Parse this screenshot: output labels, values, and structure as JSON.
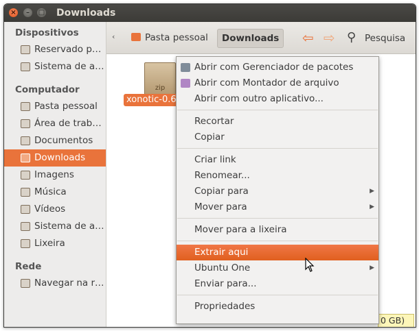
{
  "window": {
    "title": "Downloads"
  },
  "sidebar": {
    "sections": [
      {
        "title": "Dispositivos",
        "items": [
          {
            "label": "Reservado p…",
            "icon": "drive-icon"
          },
          {
            "label": "Sistema de a…",
            "icon": "drive-icon"
          }
        ]
      },
      {
        "title": "Computador",
        "items": [
          {
            "label": "Pasta pessoal",
            "icon": "home-folder-icon"
          },
          {
            "label": "Área de trab…",
            "icon": "desktop-icon"
          },
          {
            "label": "Documentos",
            "icon": "documents-folder-icon"
          },
          {
            "label": "Downloads",
            "icon": "downloads-folder-icon",
            "active": true
          },
          {
            "label": "Imagens",
            "icon": "pictures-folder-icon"
          },
          {
            "label": "Música",
            "icon": "music-folder-icon"
          },
          {
            "label": "Vídeos",
            "icon": "videos-folder-icon"
          },
          {
            "label": "Sistema de a…",
            "icon": "filesystem-icon"
          },
          {
            "label": "Lixeira",
            "icon": "trash-icon"
          }
        ]
      },
      {
        "title": "Rede",
        "items": [
          {
            "label": "Navegar na r…",
            "icon": "network-icon"
          }
        ]
      }
    ]
  },
  "toolbar": {
    "breadcrumbs": [
      "Pasta pessoal",
      "Downloads"
    ],
    "search_label": "Pesquisa"
  },
  "file": {
    "name": "xonotic-0.6",
    "type_label": "zip"
  },
  "status": {
    "free_space": "0 GB)"
  },
  "context_menu": {
    "items": [
      {
        "label": "Abrir com Gerenciador de pacotes",
        "icon": "package-manager-icon"
      },
      {
        "label": "Abrir com Montador de arquivo",
        "icon": "archive-mounter-icon"
      },
      {
        "label": "Abrir com outro aplicativo..."
      },
      {
        "separator": true
      },
      {
        "label": "Recortar"
      },
      {
        "label": "Copiar"
      },
      {
        "separator": true
      },
      {
        "label": "Criar link"
      },
      {
        "label": "Renomear..."
      },
      {
        "label": "Copiar para",
        "submenu": true
      },
      {
        "label": "Mover para",
        "submenu": true
      },
      {
        "separator": true
      },
      {
        "label": "Mover para a lixeira"
      },
      {
        "separator": true
      },
      {
        "label": "Extrair aqui",
        "highlighted": true
      },
      {
        "label": "Ubuntu One",
        "submenu": true
      },
      {
        "label": "Enviar para..."
      },
      {
        "separator": true
      },
      {
        "label": "Propriedades"
      }
    ]
  },
  "colors": {
    "accent": "#e9733b",
    "titlebar": "#3c3b37",
    "sidebar": "#edeceb",
    "menu": "#f2f1f0"
  }
}
